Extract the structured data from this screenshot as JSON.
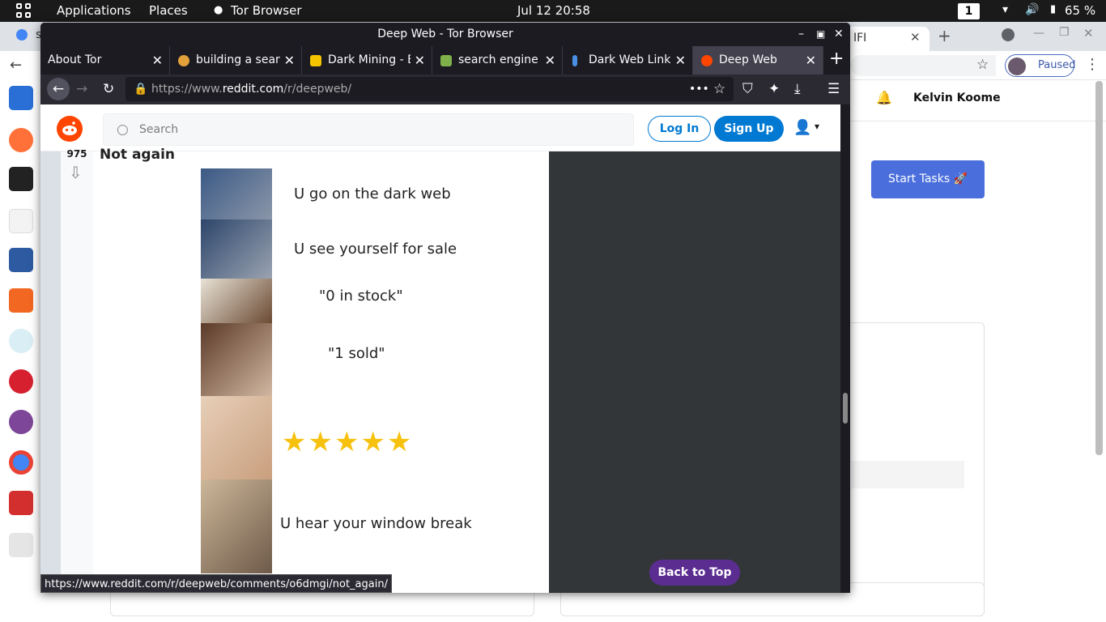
{
  "topbar": {
    "applications": "Applications",
    "places": "Places",
    "app_name": "Tor Browser",
    "clock": "Jul 12  20:58",
    "workspace": "1",
    "battery": "65 %"
  },
  "background_chrome": {
    "tab_partial_left": "s",
    "tab_partial_right": "IFI",
    "paused_label": "Paused",
    "user_name": "Kelvin Koome",
    "start_tasks": "Start Tasks 🚀"
  },
  "tor_window": {
    "title": "Deep Web - Tor Browser",
    "tabs": [
      {
        "label": "About Tor",
        "color": "#1c1b22"
      },
      {
        "label": "building a searc",
        "color": "#e2a13a"
      },
      {
        "label": "Dark Mining - E",
        "color": "#f5c400"
      },
      {
        "label": "search engine -",
        "color": "#7fb24b"
      },
      {
        "label": "Dark Web Links",
        "color": "#4a90e2"
      },
      {
        "label": "Deep Web",
        "color": "#ff4500"
      }
    ],
    "url_prefix": "https://www.",
    "url_domain": "reddit.com",
    "url_path": "/r/deepweb/",
    "status_link": "https://www.reddit.com/r/deepweb/comments/o6dmgi/not_again/"
  },
  "reddit": {
    "search_placeholder": "Search",
    "login": "Log In",
    "signup": "Sign Up",
    "post": {
      "votes": "975",
      "title": "Not again",
      "meme_lines": [
        "U go on the dark web",
        "U see yourself for sale",
        "\"0 in stock\"",
        "\"1 sold\"",
        "U hear your window break"
      ],
      "stars": 5
    },
    "back_to_top": "Back to Top"
  },
  "colors": {
    "reddit_orange": "#ff4500",
    "reddit_blue": "#0079d3",
    "back_to_top": "#5c2d91",
    "start_tasks": "#4a6fdc"
  }
}
